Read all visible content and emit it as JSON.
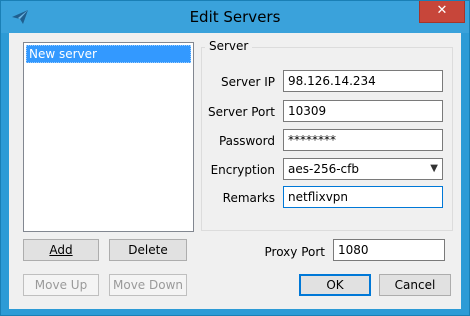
{
  "window": {
    "title": "Edit Servers",
    "close_glyph": "✕",
    "icon": "paper-plane-icon"
  },
  "servers": {
    "items": [
      {
        "label": "New server",
        "selected": true
      }
    ]
  },
  "list_buttons": {
    "add": "Add",
    "delete": "Delete",
    "move_up": "Move Up",
    "move_down": "Move Down"
  },
  "server_group": {
    "title": "Server",
    "ip_label": "Server IP",
    "ip_value": "98.126.14.234",
    "port_label": "Server Port",
    "port_value": "10309",
    "password_label": "Password",
    "password_value": "********",
    "encryption_label": "Encryption",
    "encryption_value": "aes-256-cfb",
    "remarks_label": "Remarks",
    "remarks_value": "netflixvpn"
  },
  "proxy": {
    "label": "Proxy Port",
    "value": "1080"
  },
  "dialog_buttons": {
    "ok": "OK",
    "cancel": "Cancel"
  },
  "colors": {
    "titlebar": "#3aa2db",
    "selection": "#3399ff",
    "close": "#c7463a",
    "focus": "#0078d7"
  }
}
